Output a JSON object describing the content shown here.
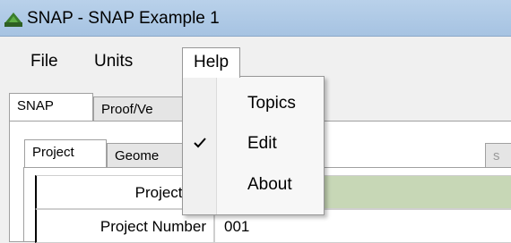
{
  "window": {
    "title": "SNAP - SNAP Example 1"
  },
  "menubar": {
    "file": "File",
    "units": "Units",
    "help": "Help"
  },
  "help_menu": {
    "topics": "Topics",
    "edit": "Edit",
    "about": "About",
    "checked_item": "Edit"
  },
  "outer_tabs": {
    "snap": "SNAP",
    "proof": "Proof/Ve"
  },
  "inner_tabs": {
    "project": "Project",
    "geometry": "Geome",
    "hidden_tail": "s"
  },
  "grid": {
    "rows": [
      {
        "label": "Project Na",
        "value": ""
      },
      {
        "label": "Project Number",
        "value": "001"
      }
    ]
  },
  "colors": {
    "titlebar": "#a6c3e2",
    "selected_value_bg": "#c7d7b6"
  }
}
